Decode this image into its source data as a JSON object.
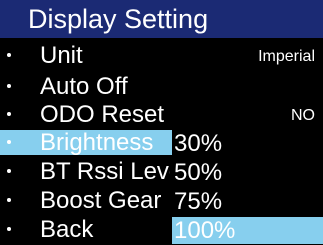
{
  "colors": {
    "title_bar": "#1b2a74",
    "highlight": "#87cfee",
    "text": "#ffffff",
    "background": "#000000"
  },
  "header": {
    "title": "Display Setting"
  },
  "menu": {
    "items": [
      {
        "label": "Unit",
        "value": "Imperial"
      },
      {
        "label": "Auto Off",
        "value": ""
      },
      {
        "label": "ODO Reset",
        "value": "NO"
      },
      {
        "label": "Brightness",
        "value": ""
      },
      {
        "label": "BT Rssi Level",
        "value": ""
      },
      {
        "label": "Boost Gear",
        "value": ""
      },
      {
        "label": "Back",
        "value": ""
      }
    ],
    "selected_item": "Brightness"
  },
  "brightness_options": {
    "options": [
      "30%",
      "50%",
      "75%",
      "100%"
    ],
    "selected": "100%"
  }
}
